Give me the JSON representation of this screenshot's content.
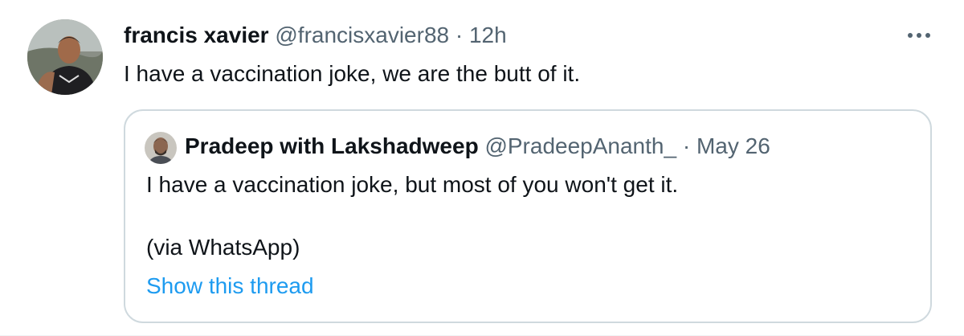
{
  "tweet": {
    "author_name": "francis xavier",
    "author_handle": "@francisxavier88",
    "separator": "·",
    "time": "12h",
    "text": "I have a vaccination joke, we are the butt of it.",
    "avatar_icon": "profile-photo-icon",
    "more_icon": "more-options-icon"
  },
  "quote": {
    "author_name": "Pradeep with Lakshadweep",
    "author_handle": "@PradeepAnanth_",
    "separator": "·",
    "date": "May 26",
    "text_line1": "I have a vaccination joke, but most of you won't get it.",
    "text_line2": "(via WhatsApp)",
    "show_thread": "Show this thread",
    "avatar_icon": "profile-photo-icon"
  },
  "colors": {
    "text": "#0f1419",
    "secondary": "#536471",
    "link": "#1d9bf0",
    "border": "#cfd9de"
  }
}
